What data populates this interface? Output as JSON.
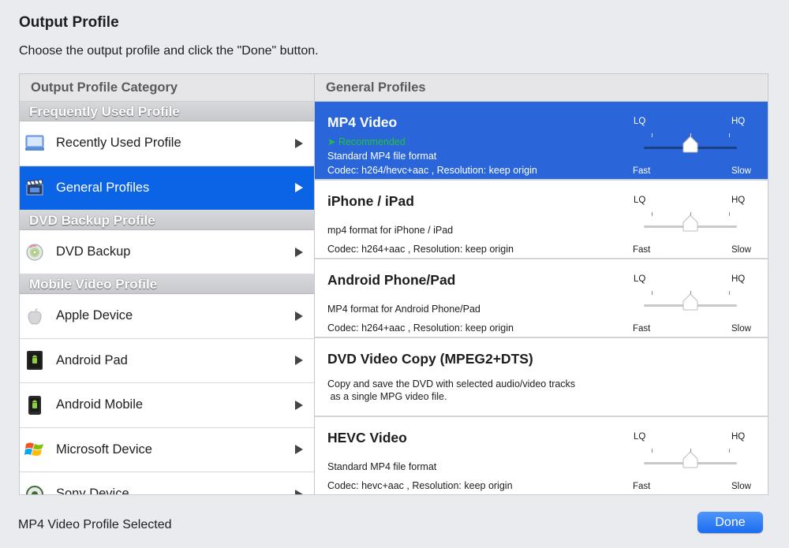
{
  "window": {
    "title": "Output Profile",
    "instruction": "Choose the output profile and click the \"Done\" button."
  },
  "left_panel": {
    "header": "Output Profile Category",
    "groups": [
      {
        "title": "Frequently Used Profile",
        "items": [
          {
            "label": "Recently Used Profile",
            "icon": "recent-profile-icon",
            "selected": false
          },
          {
            "label": "General Profiles",
            "icon": "film-clapper-icon",
            "selected": true
          }
        ]
      },
      {
        "title": "DVD Backup Profile",
        "items": [
          {
            "label": "DVD Backup",
            "icon": "dvd-disc-icon",
            "selected": false
          }
        ]
      },
      {
        "title": "Mobile Video Profile",
        "items": [
          {
            "label": "Apple Device",
            "icon": "apple-logo-icon",
            "selected": false
          },
          {
            "label": "Android Pad",
            "icon": "android-pad-icon",
            "selected": false
          },
          {
            "label": "Android Mobile",
            "icon": "android-mobile-icon",
            "selected": false
          },
          {
            "label": "Microsoft Device",
            "icon": "windows-logo-icon",
            "selected": false
          },
          {
            "label": "Sony Device",
            "icon": "sony-device-icon",
            "selected": false
          }
        ]
      }
    ]
  },
  "right_panel": {
    "header": "General Profiles",
    "profiles": [
      {
        "name": "MP4 Video",
        "recommended": "➤ Recommended",
        "description": "Standard MP4 file format",
        "codec": "Codec: h264/hevc+aac , Resolution: keep origin",
        "quality": {
          "lq": "LQ",
          "hq": "HQ",
          "fast": "Fast",
          "slow": "Slow",
          "level": 0.5
        },
        "selected": true
      },
      {
        "name": "iPhone / iPad",
        "description": "mp4 format for iPhone / iPad",
        "codec": "Codec: h264+aac , Resolution: keep origin",
        "quality": {
          "lq": "LQ",
          "hq": "HQ",
          "fast": "Fast",
          "slow": "Slow",
          "level": 0.5
        },
        "selected": false
      },
      {
        "name": "Android Phone/Pad",
        "description": "MP4 format for Android Phone/Pad",
        "codec": "Codec: h264+aac , Resolution: keep origin",
        "quality": {
          "lq": "LQ",
          "hq": "HQ",
          "fast": "Fast",
          "slow": "Slow",
          "level": 0.5
        },
        "selected": false
      },
      {
        "name": "DVD Video Copy (MPEG2+DTS)",
        "description_lines": [
          "Copy and save the DVD with selected audio/video tracks",
          " as a single MPG video file."
        ],
        "selected": false
      },
      {
        "name": "HEVC Video",
        "description": "Standard MP4 file format",
        "codec": "Codec: hevc+aac , Resolution: keep origin",
        "quality": {
          "lq": "LQ",
          "hq": "HQ",
          "fast": "Fast",
          "slow": "Slow",
          "level": 0.5
        },
        "selected": false
      }
    ]
  },
  "footer": {
    "status": "MP4 Video Profile Selected",
    "done_label": "Done"
  },
  "colors": {
    "selection_blue": "#0b63e5",
    "profile_selected_blue": "#2a66d9",
    "recommended_green": "#22c13a",
    "done_button": "#1b6cf0"
  }
}
